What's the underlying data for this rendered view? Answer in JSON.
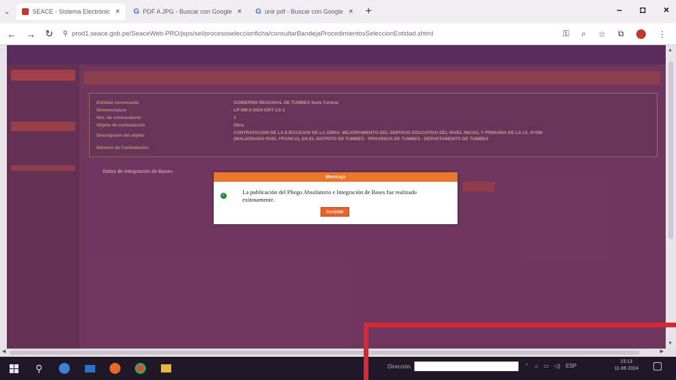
{
  "browser": {
    "tabs": [
      {
        "label": "SEACE - Sistema Electrónic",
        "active": true
      },
      {
        "label": "PDF A JPG - Buscar con Google",
        "active": false
      },
      {
        "label": "unir pdf - Buscar con Google",
        "active": false
      }
    ],
    "url": "prod1.seace.gob.pe/SeaceWeb-PRO/jsps/sel/procesoseleccionficha/consultarBandejaProcedimientosSeleccionEntidad.xhtml"
  },
  "modal": {
    "title": "Mensaje",
    "message": "La publicación del Pliego Absolutorio e Integración de Bases fue realizado exitosamente.",
    "ok_label": "Aceptar"
  },
  "page": {
    "info_labels": [
      "Entidad convocante",
      "Nomenclatura",
      "Nro. de convocatoria",
      "Objeto de contratación",
      "Descripción del objeto",
      "Número de Contratación"
    ],
    "info_values": [
      "GOBIERNO REGIONAL DE TUMBES Sede Central",
      "LP-SM-3-2024-GRT-CS-1",
      "1",
      "Obra",
      "CONTRATACION DE LA EJECUCION DE LA OBRA: MEJORAMIENTO DEL SERVICIO EDUCATIVO DEL NIVEL INICIAL Y PRIMARIA DE LA I.E. N°090",
      "(MALDONADO PUEL FRANCO), EN EL DISTRITO DE TUMBES - PROVINCIA DE TUMBES - DEPARTAMENTO DE TUMBES"
    ],
    "section_label": "Datos de Integración de Bases"
  },
  "taskbar": {
    "address_label": "Dirección",
    "address_value": "",
    "lang": "ESP",
    "time": "23:13",
    "date": "11-06-2024"
  },
  "colors": {
    "page_bg": "#7a3d66",
    "modal_header": "#e8772b",
    "ok_button": "#e8622b",
    "annotation": "#d42a35"
  }
}
